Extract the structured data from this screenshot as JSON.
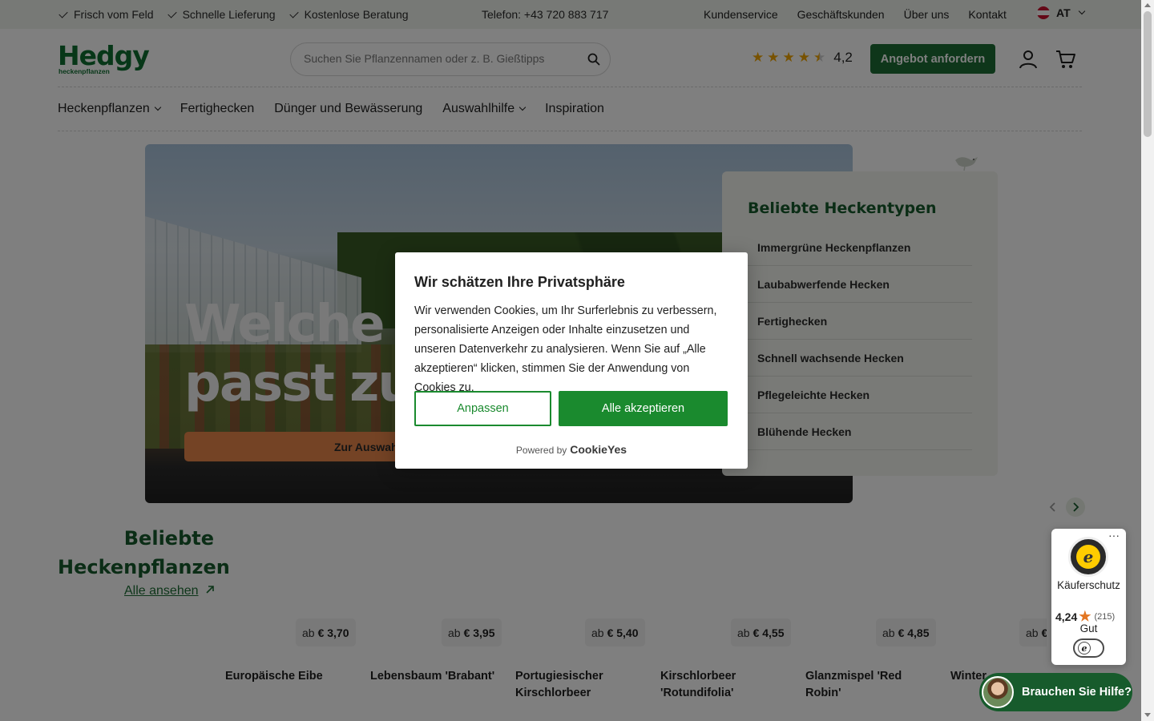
{
  "topbar": {
    "usps": [
      "Frisch vom Feld",
      "Schnelle Lieferung",
      "Kostenlose Beratung"
    ],
    "phone": "Telefon: +43 720 883 717",
    "links": [
      "Kundenservice",
      "Geschäftskunden",
      "Über uns",
      "Kontakt"
    ],
    "country": "AT"
  },
  "header": {
    "logo": "Hedgy",
    "logo_sub": "heckenpflanzen",
    "search_placeholder": "Suchen Sie Pflanzennamen oder z. B. Gießtipps",
    "rating_value": "4,2",
    "rating_stars": 4.5,
    "quote_button": "Angebot anfordern"
  },
  "nav": {
    "items": [
      "Heckenpflanzen",
      "Fertighecken",
      "Dünger und Bewässerung",
      "Auswahlhilfe",
      "Inspiration"
    ]
  },
  "hero": {
    "title_line1": "Welche",
    "title_line2": "passt zu",
    "cta": "Zur Auswahl"
  },
  "hedge_types": {
    "title": "Beliebte Heckentypen",
    "items": [
      "Immergrüne Heckenpflanzen",
      "Laubabwerfende Hecken",
      "Fertighecken",
      "Schnell wachsende Hecken",
      "Pflegeleichte Hecken",
      "Blühende Hecken"
    ]
  },
  "popular": {
    "title": "Beliebte Heckenpflanzen",
    "link": "Alle ansehen",
    "price_prefix": "ab",
    "products": [
      {
        "name": "Europäische Eibe",
        "price": "€ 3,70"
      },
      {
        "name": "Lebensbaum 'Brabant'",
        "price": "€ 3,95"
      },
      {
        "name": "Portugiesischer Kirschlorbeer",
        "price": "€ 5,40"
      },
      {
        "name": "Kirschlorbeer 'Rotundifolia'",
        "price": "€ 4,55"
      },
      {
        "name": "Glanzmispel 'Red Robin'",
        "price": "€ 4,85"
      },
      {
        "name": "Winter",
        "price": "€"
      }
    ]
  },
  "cookie": {
    "title": "Wir schätzen Ihre Privatsphäre",
    "text": "Wir verwenden Cookies, um Ihr Surferlebnis zu verbessern, personalisierte Anzeigen oder Inhalte einzusetzen und unseren Datenverkehr zu analysieren. Wenn Sie auf „Alle akzeptieren“ klicken, stimmen Sie der Anwendung von Cookies zu.",
    "customize": "Anpassen",
    "accept_all": "Alle akzeptieren",
    "powered_by": "Powered by",
    "brand": "CookieYes"
  },
  "trusted_shops": {
    "label": "Käuferschutz",
    "score": "4,24",
    "count": "(215)",
    "grade": "Gut"
  },
  "help_button": "Brauchen Sie Hilfe?",
  "colors": {
    "brand_green": "#1d6d35",
    "dark_green": "#175b2c",
    "cookie_green": "#1a8a2e",
    "hero_cta": "#e8874b",
    "star": "#f0a500"
  }
}
